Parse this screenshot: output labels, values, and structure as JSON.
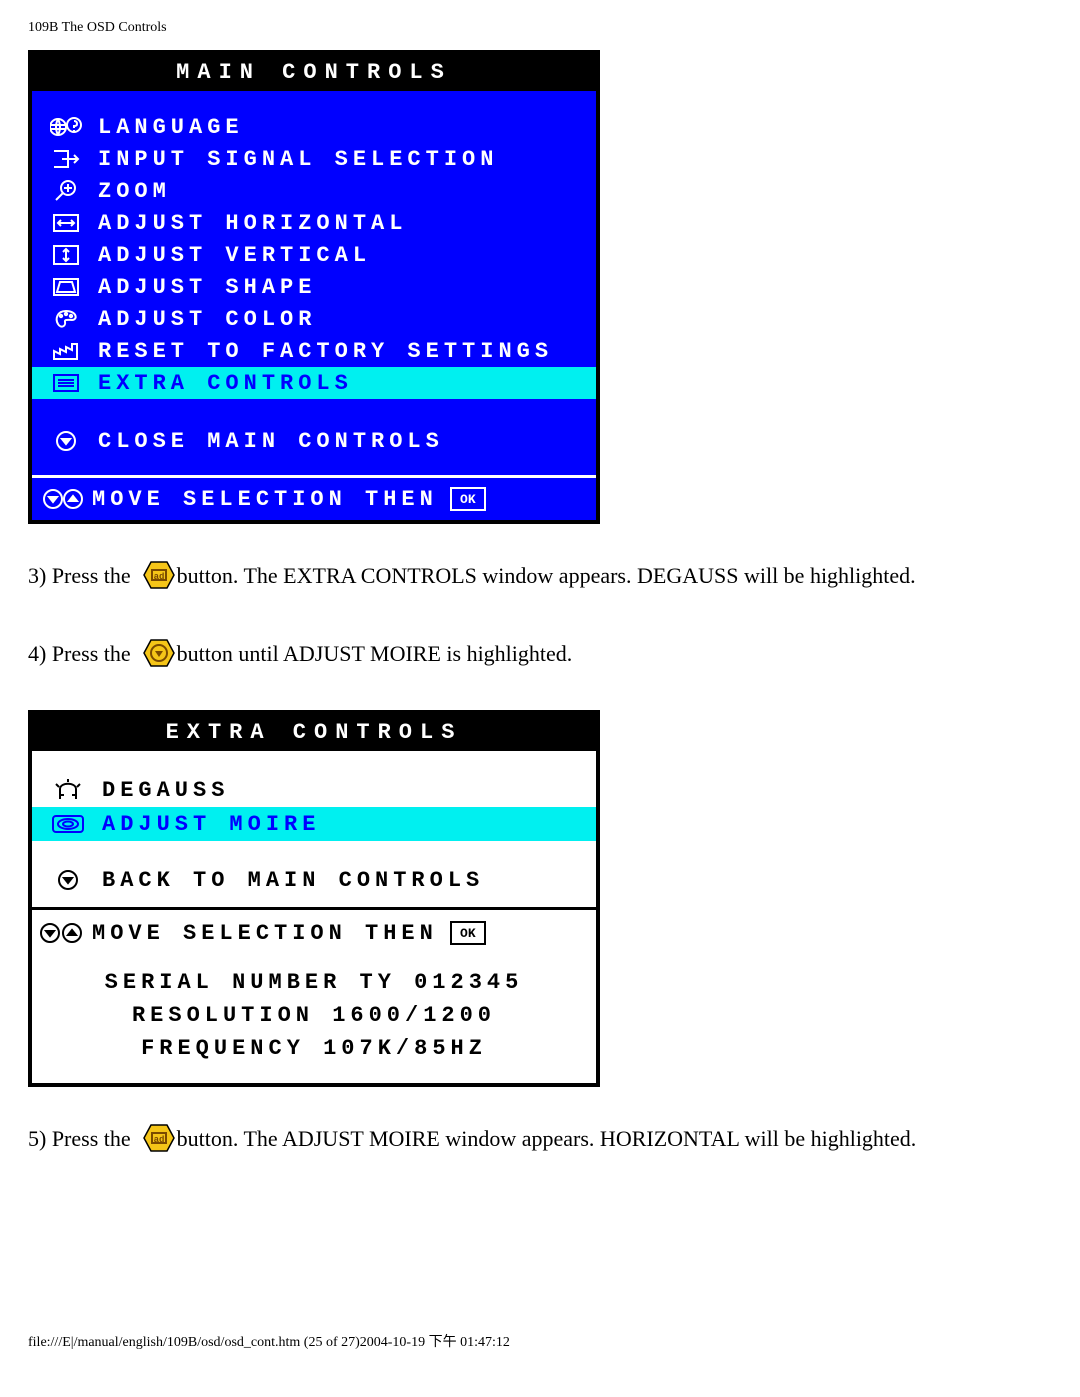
{
  "page_header": "109B The OSD Controls",
  "main_controls": {
    "title": "MAIN CONTROLS",
    "items": [
      {
        "icon": "globe-question-icon",
        "label": "LANGUAGE"
      },
      {
        "icon": "input-arrow-icon",
        "label": "INPUT SIGNAL SELECTION"
      },
      {
        "icon": "magnifier-plus-icon",
        "label": "ZOOM"
      },
      {
        "icon": "horizontal-arrows-icon",
        "label": "ADJUST HORIZONTAL"
      },
      {
        "icon": "vertical-arrows-icon",
        "label": "ADJUST VERTICAL"
      },
      {
        "icon": "shape-trapezoid-icon",
        "label": "ADJUST SHAPE"
      },
      {
        "icon": "palette-icon",
        "label": "ADJUST COLOR"
      },
      {
        "icon": "factory-icon",
        "label": "RESET TO FACTORY SETTINGS"
      },
      {
        "icon": "list-box-icon",
        "label": "EXTRA CONTROLS",
        "highlight": true
      }
    ],
    "close_label": "CLOSE MAIN CONTROLS",
    "footer_text": "MOVE SELECTION THEN",
    "footer_ok": "OK"
  },
  "steps": {
    "s3_a": "3) Press the",
    "s3_b": "button. The EXTRA CONTROLS window appears. DEGAUSS will be highlighted.",
    "s4_a": "4) Press the",
    "s4_b": "button until ADJUST MOIRE is highlighted.",
    "s5_a": "5) Press the",
    "s5_b": "button. The ADJUST MOIRE window appears. HORIZONTAL will be highlighted."
  },
  "extra_controls": {
    "title": "EXTRA CONTROLS",
    "items": [
      {
        "icon": "magnet-icon",
        "label": "DEGAUSS"
      },
      {
        "icon": "moire-icon",
        "label": "ADJUST MOIRE",
        "highlight": true
      }
    ],
    "back_label": "BACK TO MAIN CONTROLS",
    "footer_text": "MOVE SELECTION THEN",
    "footer_ok": "OK",
    "info": {
      "serial": "SERIAL NUMBER TY 012345",
      "resolution": "RESOLUTION 1600/1200",
      "frequency": "FREQUENCY 107K/85HZ"
    }
  },
  "page_footer": "file:///E|/manual/english/109B/osd/osd_cont.htm (25 of 27)2004-10-19 下午 01:47:12",
  "button_ok_label": "ad",
  "colors": {
    "osd_blue": "#0000ff",
    "osd_cyan": "#00f0f0",
    "button_yellow": "#f5c518"
  }
}
